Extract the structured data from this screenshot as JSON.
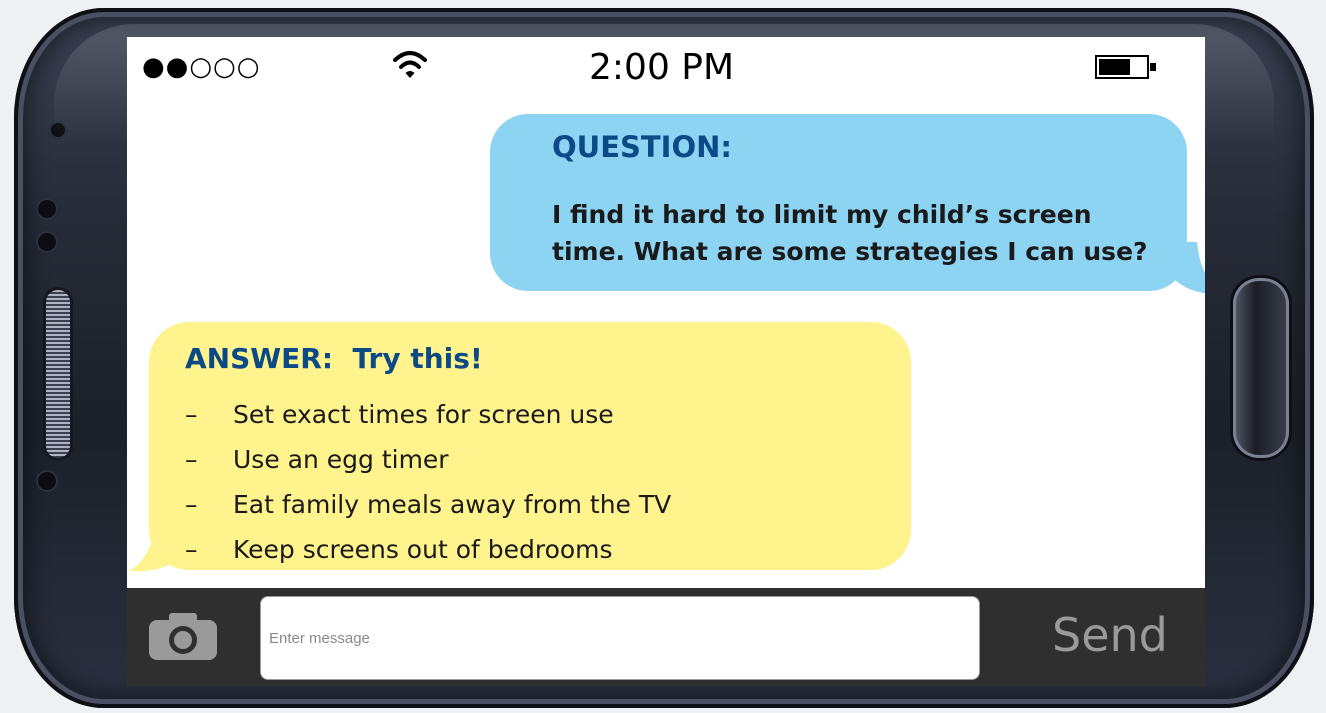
{
  "status_bar": {
    "signal": "●●○○○",
    "time": "2:00 PM",
    "battery_level": 0.7
  },
  "question": {
    "title": "QUESTION:",
    "body": "I find it hard to limit my child’s screen time. What are some strategies I can use?"
  },
  "answer": {
    "title": "ANSWER:  Try this!",
    "items": [
      "Set exact times for screen use",
      "Use an egg timer",
      "Eat family meals away from the TV",
      "Keep screens out of bedrooms"
    ]
  },
  "compose": {
    "placeholder": "Enter message",
    "send_label": "Send",
    "camera_icon": "camera-icon"
  },
  "colors": {
    "question_bubble": "#8dd3f2",
    "answer_bubble": "#fff38d",
    "heading": "#0b4a86",
    "compose_bar": "#2f2f2f"
  }
}
